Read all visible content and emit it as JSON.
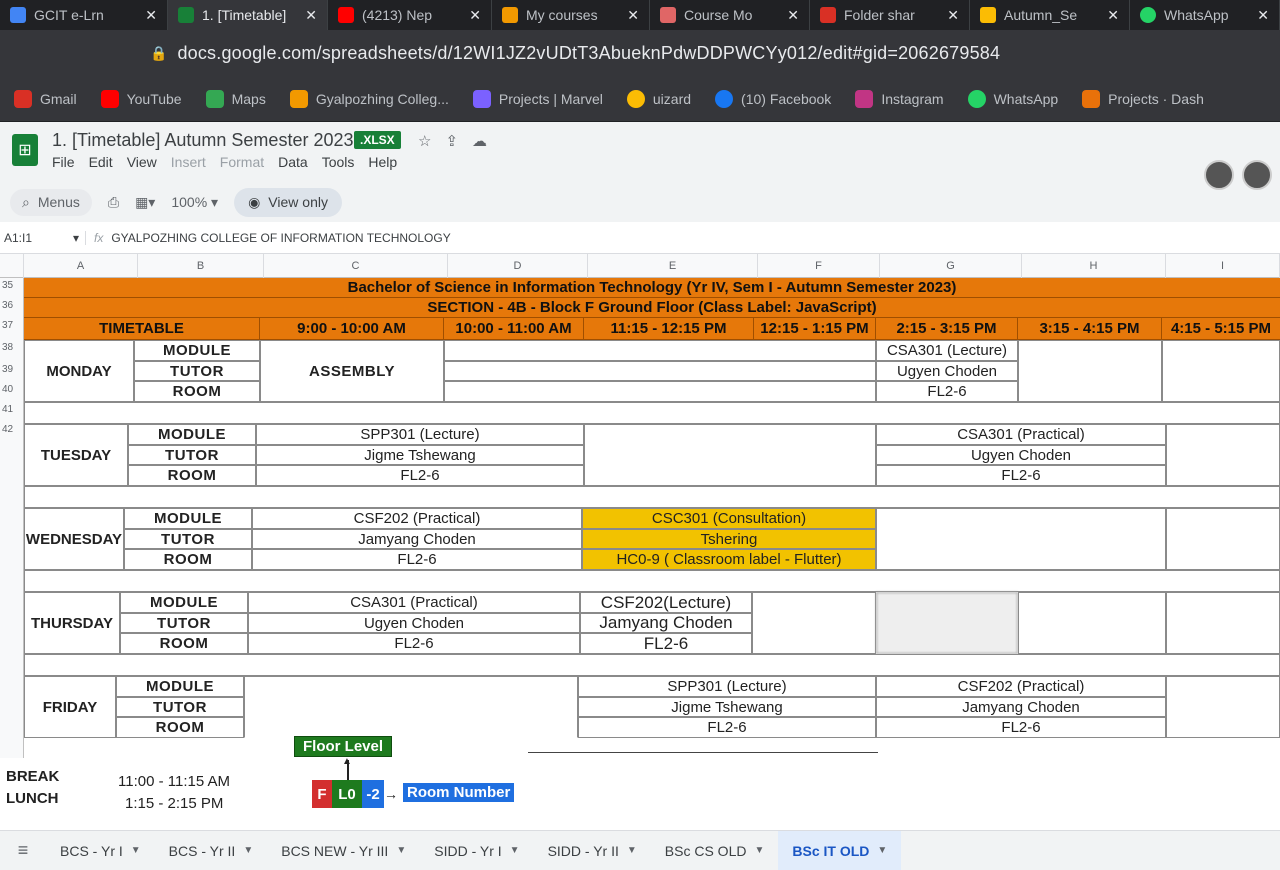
{
  "browser": {
    "tabs": [
      {
        "label": "GCIT e-Lrn",
        "color": "#4285f4"
      },
      {
        "label": "1. [Timetable]",
        "color": "#188038"
      },
      {
        "label": "(4213) Nep",
        "color": "#ff0000"
      },
      {
        "label": "My courses",
        "color": "#f29900"
      },
      {
        "label": "Course Mo",
        "color": "#e06666"
      },
      {
        "label": "Folder shar",
        "color": "#d93025"
      },
      {
        "label": "Autumn_Se",
        "color": "#fbbc04"
      },
      {
        "label": "WhatsApp",
        "color": "#25d366"
      }
    ],
    "url": "docs.google.com/spreadsheets/d/12WI1JZ2vUDtT3AbueknPdwDDPWCYy012/edit#gid=2062679584",
    "bookmarks": [
      {
        "label": "Gmail",
        "color": "#d93025"
      },
      {
        "label": "YouTube",
        "color": "#ff0000"
      },
      {
        "label": "Maps",
        "color": "#34a853"
      },
      {
        "label": "Gyalpozhing Colleg...",
        "color": "#f29900"
      },
      {
        "label": "Projects | Marvel",
        "color": "#7b61ff"
      },
      {
        "label": "uizard",
        "color": "#fbbc04"
      },
      {
        "label": "(10) Facebook",
        "color": "#1877f2"
      },
      {
        "label": "Instagram",
        "color": "#c13584"
      },
      {
        "label": "WhatsApp",
        "color": "#25d366"
      },
      {
        "label": "Projects · Dash",
        "color": "#e8710a"
      }
    ]
  },
  "doc": {
    "title": "1. [Timetable] Autumn Semester 2023",
    "badge": ".XLSX",
    "menus": [
      "File",
      "Edit",
      "View",
      "Insert",
      "Format",
      "Data",
      "Tools",
      "Help"
    ],
    "search_label": "Menus",
    "zoom": "100%",
    "view_only": "View only"
  },
  "formula_bar": {
    "cell_ref": "A1:I1",
    "content": "GYALPOZHING COLLEGE OF INFORMATION TECHNOLOGY"
  },
  "columns": [
    "A",
    "B",
    "C",
    "D",
    "E",
    "F",
    "G",
    "H",
    "I"
  ],
  "row_numbers": [
    "35",
    "36",
    "37",
    "38",
    "39",
    "40",
    "41",
    "42"
  ],
  "timetable": {
    "title": "Bachelor of Science in Information Technology (Yr IV, Sem I - Autumn Semester 2023)",
    "section": "SECTION - 4B - Block F Ground Floor (Class Label: JavaScript)",
    "timetable_label": "TIMETABLE",
    "slots": [
      "9:00 - 10:00 AM",
      "10:00 - 11:00 AM",
      "11:15 - 12:15 PM",
      "12:15 - 1:15 PM",
      "2:15 - 3:15 PM",
      "3:15 - 4:15 PM",
      "4:15 - 5:15 PM"
    ],
    "row_labels": [
      "MODULE",
      "TUTOR",
      "ROOM"
    ],
    "days": {
      "monday": "MONDAY",
      "tuesday": "TUESDAY",
      "wednesday": "WEDNESDAY",
      "thursday": "THURSDAY",
      "friday": "FRIDAY"
    },
    "monday": {
      "assembly": "ASSEMBLY",
      "pm": {
        "module": "CSA301 (Lecture)",
        "tutor": "Ugyen Choden",
        "room": "FL2-6"
      }
    },
    "tuesday": {
      "am": {
        "module": "SPP301 (Lecture)",
        "tutor": "Jigme Tshewang",
        "room": "FL2-6"
      },
      "pm": {
        "module": "CSA301 (Practical)",
        "tutor": "Ugyen Choden",
        "room": "FL2-6"
      }
    },
    "wednesday": {
      "am": {
        "module": "CSF202 (Practical)",
        "tutor": "Jamyang Choden",
        "room": "FL2-6"
      },
      "mid": {
        "module": "CSC301 (Consultation)",
        "tutor": "Tshering",
        "room": "HC0-9 ( Classroom label - Flutter)"
      }
    },
    "thursday": {
      "am": {
        "module": "CSA301 (Practical)",
        "tutor": "Ugyen Choden",
        "room": "FL2-6"
      },
      "mid": {
        "module": "CSF202(Lecture)",
        "tutor": "Jamyang Choden",
        "room": "FL2-6"
      }
    },
    "friday": {
      "mid": {
        "module": "SPP301 (Lecture)",
        "tutor": "Jigme Tshewang",
        "room": "FL2-6"
      },
      "pm": {
        "module": "CSF202 (Practical)",
        "tutor": "Jamyang Choden",
        "room": "FL2-6"
      }
    },
    "break_label": "BREAK",
    "break_time": "11:00 - 11:15 AM",
    "lunch_label": "LUNCH",
    "lunch_time": "1:15 - 2:15 PM"
  },
  "legend": {
    "floor_level": "Floor Level",
    "f": "F",
    "level": "L0",
    "room": "-2",
    "room_number": "Room Number",
    "colors": {
      "green": "#1e7a1e",
      "red": "#d32f2f",
      "blue": "#1f6fe0"
    }
  },
  "sheet_tabs": [
    "BCS - Yr I",
    "BCS - Yr II",
    "BCS NEW - Yr III",
    "SIDD - Yr I",
    "SIDD - Yr II",
    "BSc CS OLD",
    "BSc IT OLD"
  ],
  "active_sheet_tab": "BSc IT OLD"
}
